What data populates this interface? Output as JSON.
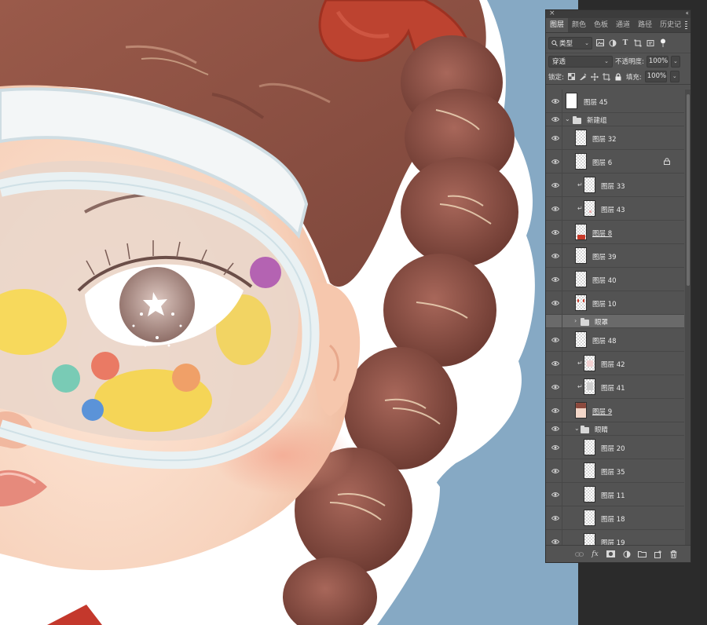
{
  "canvas": {
    "description_colors": {
      "background": "#86a9c4",
      "hair": "#8c4f42",
      "skin": "#f6d2bd",
      "goggle": "#e8eef0",
      "bow": "#b8412f",
      "outline": "#ffffff"
    }
  },
  "panel": {
    "tabs": [
      "图层",
      "颜色",
      "色板",
      "通道",
      "路径",
      "历史记"
    ],
    "filter": {
      "kind_label": "类型"
    },
    "blend": {
      "mode": "穿透",
      "opacity_label": "不透明度:",
      "opacity_value": "100%"
    },
    "lock": {
      "label": "锁定:",
      "fill_label": "填充:",
      "fill_value": "100%"
    },
    "layers": [
      {
        "name": "图层 45"
      },
      {
        "name": "新建组"
      },
      {
        "name": "图层 32"
      },
      {
        "name": "图层 6"
      },
      {
        "name": "图层 33"
      },
      {
        "name": "图层 43"
      },
      {
        "name": "图层 8"
      },
      {
        "name": "图层 39"
      },
      {
        "name": "图层 40"
      },
      {
        "name": "图层 10"
      },
      {
        "name": "眼罩"
      },
      {
        "name": "图层 48"
      },
      {
        "name": "图层 42"
      },
      {
        "name": "图层 41"
      },
      {
        "name": "图层 9"
      },
      {
        "name": "眼睛"
      },
      {
        "name": "图层 20"
      },
      {
        "name": "图层 35"
      },
      {
        "name": "图层 11"
      },
      {
        "name": "图层 18"
      },
      {
        "name": "图层 19"
      }
    ],
    "icons": {
      "filter": [
        "image-filter-icon",
        "adjustment-filter-icon",
        "type-filter-icon",
        "shape-filter-icon",
        "smart-object-filter-icon",
        "filter-toggle-icon"
      ],
      "lock": [
        "lock-transparent-icon",
        "lock-image-icon",
        "lock-position-icon",
        "lock-artboard-icon",
        "lock-all-icon"
      ],
      "bottom": [
        "link-layers-icon",
        "fx-icon",
        "add-mask-icon",
        "adjustment-layer-icon",
        "new-group-icon",
        "new-layer-icon",
        "delete-layer-icon"
      ]
    }
  }
}
